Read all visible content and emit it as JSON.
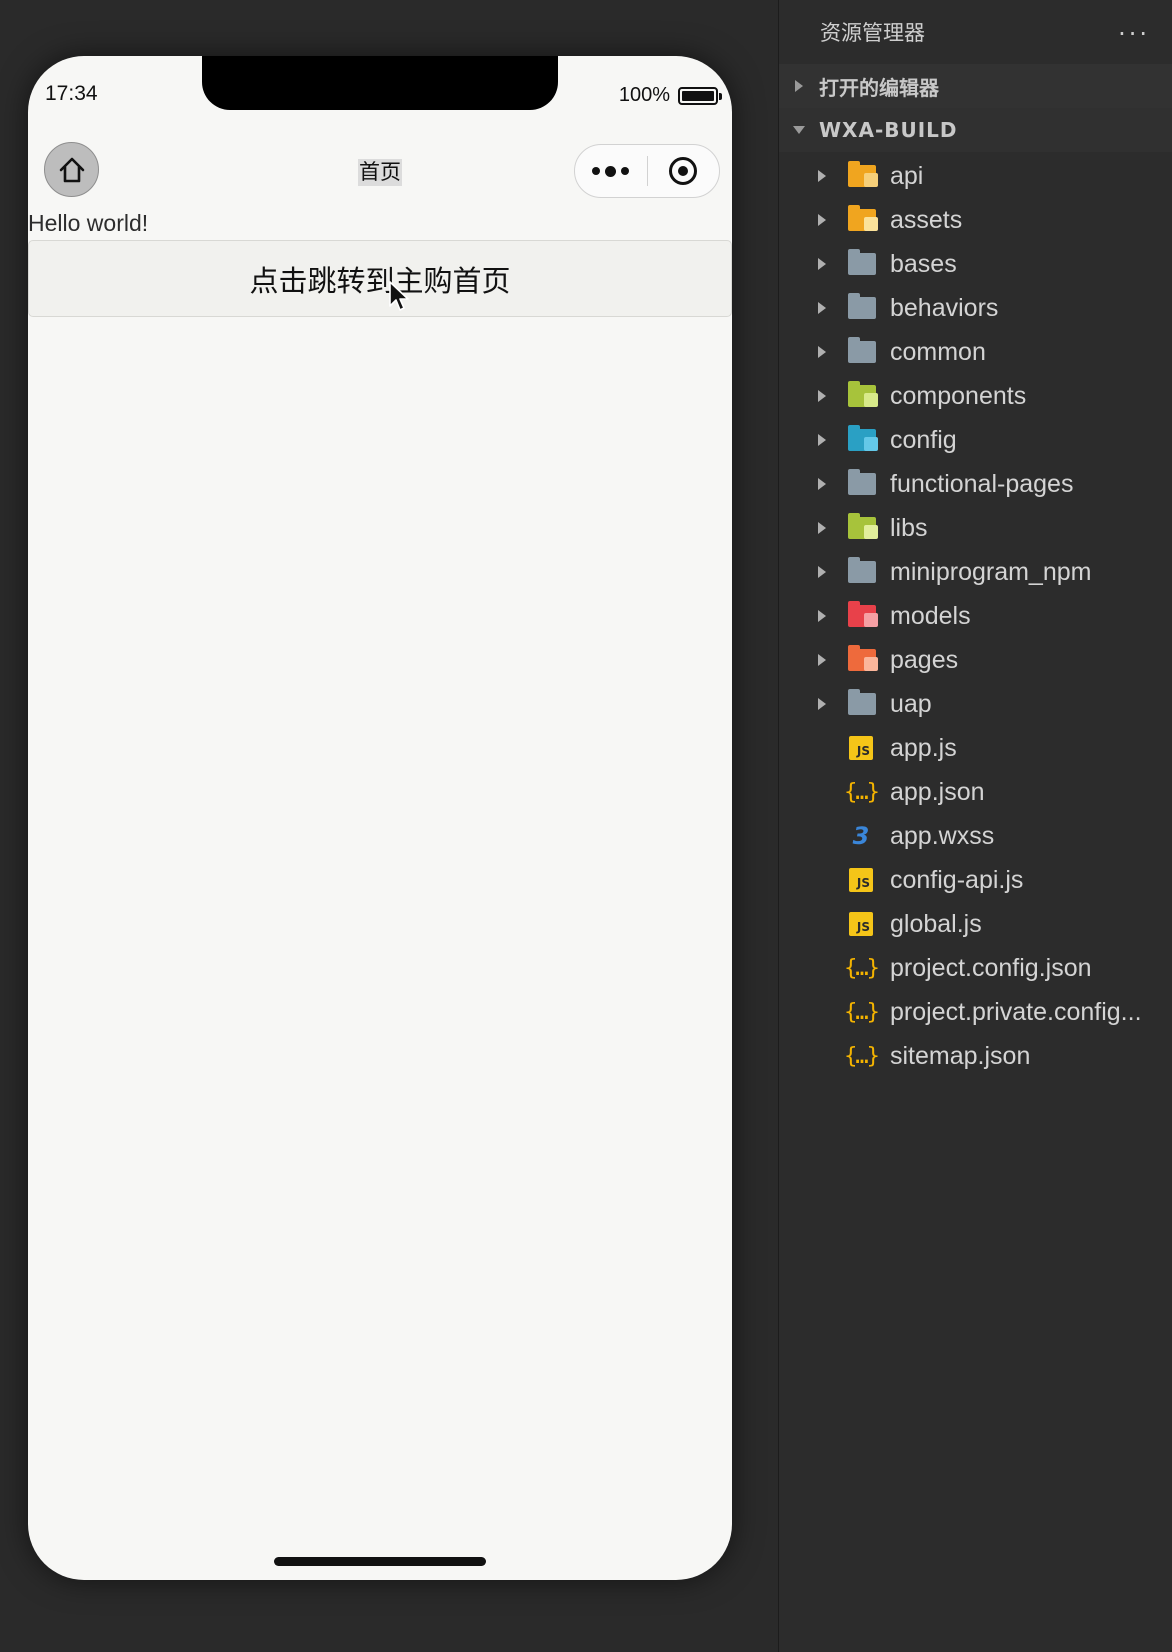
{
  "simulator": {
    "status_time": "17:34",
    "battery_percent": "100%",
    "nav_title": "首页",
    "hello_text": "Hello world!",
    "jump_button_label": "点击跳转到主购首页"
  },
  "explorer": {
    "title": "资源管理器",
    "more": "···",
    "open_editors_label": "打开的编辑器",
    "project_name": "WXA-BUILD",
    "folders": [
      {
        "name": "api",
        "icon": "folder-api-icon",
        "color": "#f0a51f",
        "badge": "#f7d07a"
      },
      {
        "name": "assets",
        "icon": "folder-assets-icon",
        "color": "#f0a51f",
        "badge": "#fbe29a"
      },
      {
        "name": "bases",
        "icon": "folder-icon",
        "color": "#8a9aa6",
        "badge": ""
      },
      {
        "name": "behaviors",
        "icon": "folder-icon",
        "color": "#8a9aa6",
        "badge": ""
      },
      {
        "name": "common",
        "icon": "folder-icon",
        "color": "#8a9aa6",
        "badge": ""
      },
      {
        "name": "components",
        "icon": "folder-components-icon",
        "color": "#a7c33b",
        "badge": "#d8ea8a"
      },
      {
        "name": "config",
        "icon": "folder-config-icon",
        "color": "#2aa0c4",
        "badge": "#64c8e8"
      },
      {
        "name": "functional-pages",
        "icon": "folder-icon",
        "color": "#8a9aa6",
        "badge": ""
      },
      {
        "name": "libs",
        "icon": "folder-libs-icon",
        "color": "#a7c33b",
        "badge": "#e2ef9c"
      },
      {
        "name": "miniprogram_npm",
        "icon": "folder-icon",
        "color": "#8a9aa6",
        "badge": ""
      },
      {
        "name": "models",
        "icon": "folder-models-icon",
        "color": "#e8414a",
        "badge": "#f6a0a4"
      },
      {
        "name": "pages",
        "icon": "folder-pages-icon",
        "color": "#ee6a3c",
        "badge": "#fbb69b"
      },
      {
        "name": "uap",
        "icon": "folder-icon",
        "color": "#8a9aa6",
        "badge": ""
      }
    ],
    "files": [
      {
        "name": "app.js",
        "type": "js"
      },
      {
        "name": "app.json",
        "type": "json"
      },
      {
        "name": "app.wxss",
        "type": "css"
      },
      {
        "name": "config-api.js",
        "type": "js"
      },
      {
        "name": "global.js",
        "type": "js"
      },
      {
        "name": "project.config.json",
        "type": "json"
      },
      {
        "name": "project.private.config...",
        "type": "json"
      },
      {
        "name": "sitemap.json",
        "type": "json"
      }
    ]
  }
}
